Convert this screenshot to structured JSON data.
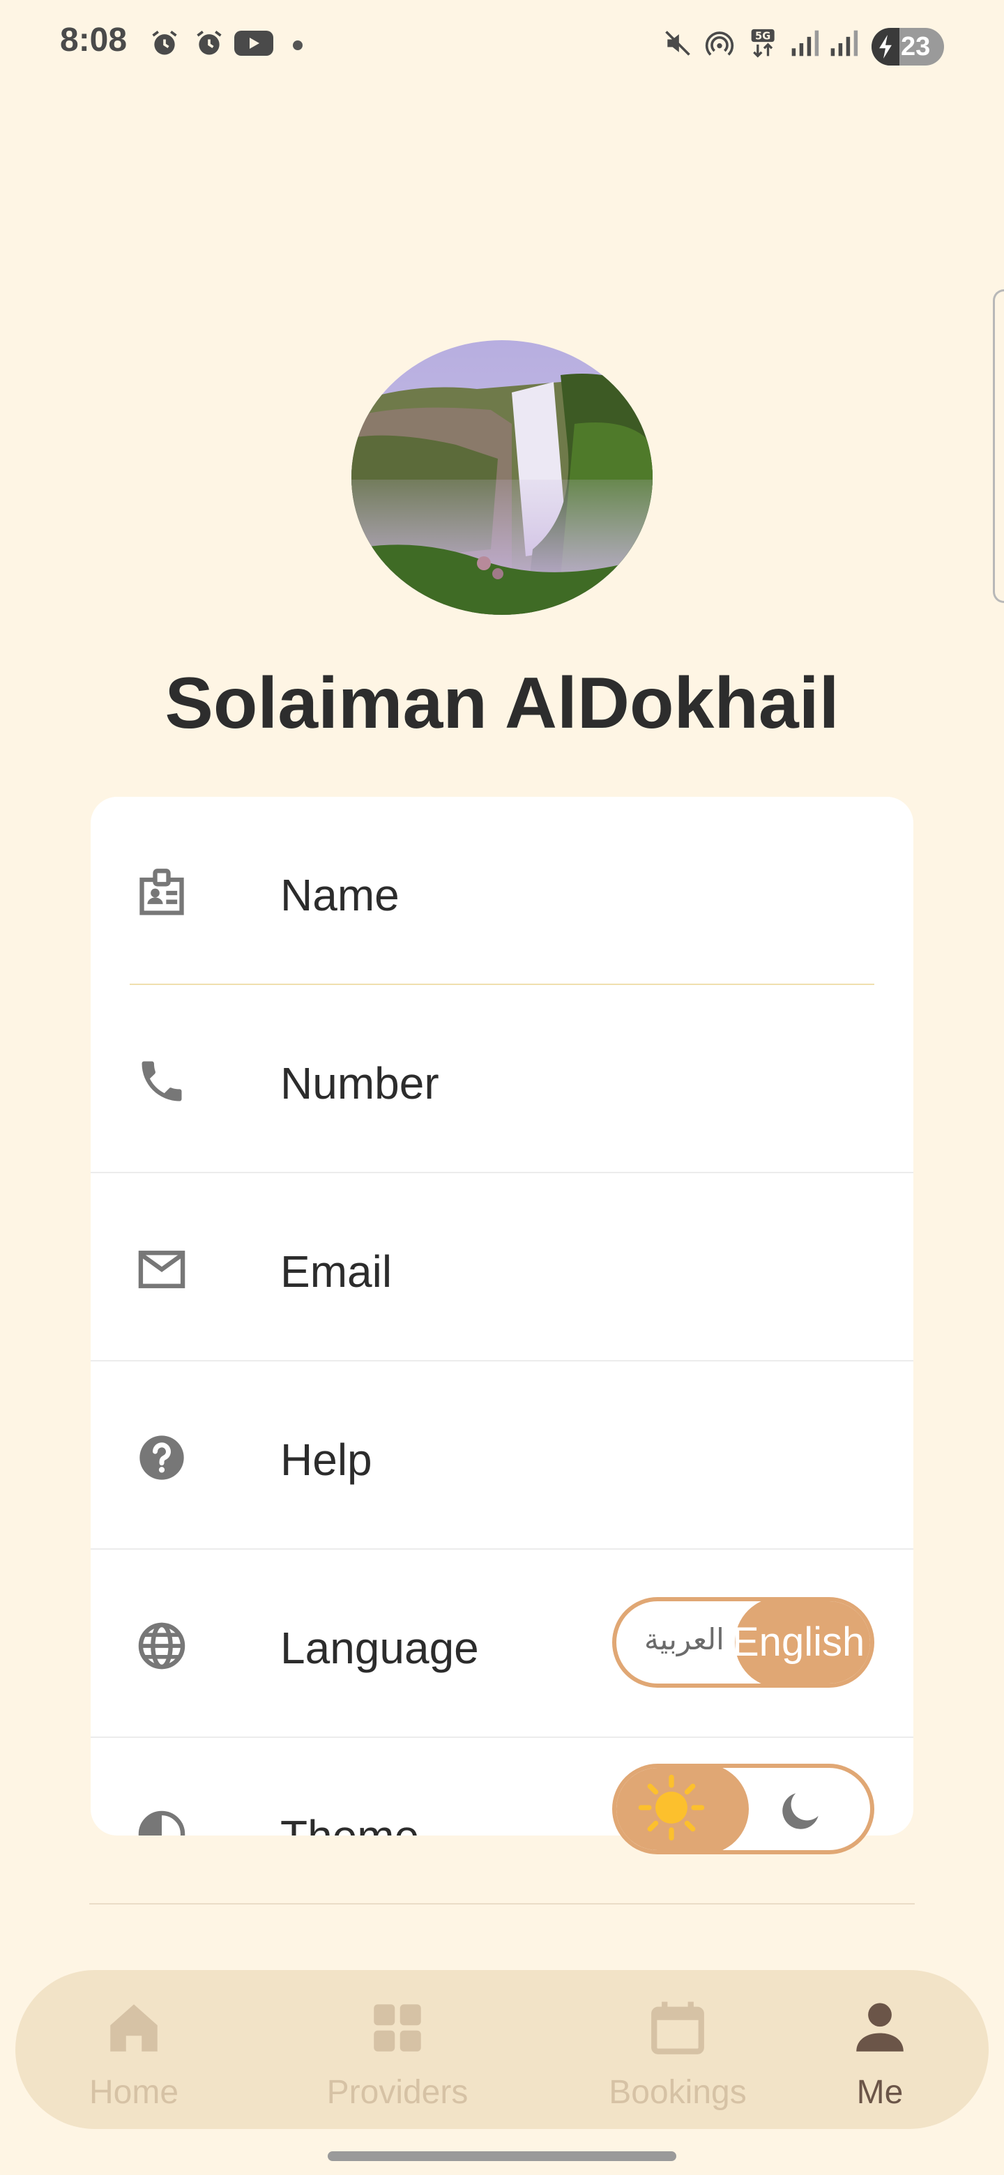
{
  "status_bar": {
    "time": "8:08",
    "icons": [
      "alarm-icon",
      "alarm-icon",
      "youtube-icon",
      "dot-icon",
      "mute-icon",
      "hotspot-icon",
      "5g-icon",
      "signal-icon",
      "signal-icon"
    ],
    "battery": "23"
  },
  "profile": {
    "name": "Solaiman AlDokhail"
  },
  "menu": [
    {
      "icon": "id-badge-icon",
      "label": "Name"
    },
    {
      "icon": "phone-icon",
      "label": "Number"
    },
    {
      "icon": "mail-icon",
      "label": "Email"
    },
    {
      "icon": "help-icon",
      "label": "Help"
    },
    {
      "icon": "globe-icon",
      "label": "Language"
    },
    {
      "icon": "contrast-icon",
      "label": "Theme"
    }
  ],
  "language_toggle": {
    "option_ar": "العربية",
    "option_en": "English",
    "selected": "English"
  },
  "theme_toggle": {
    "selected": "light"
  },
  "nav": {
    "items": [
      {
        "label": "Home",
        "icon": "home-icon"
      },
      {
        "label": "Providers",
        "icon": "grid-icon"
      },
      {
        "label": "Bookings",
        "icon": "calendar-icon"
      },
      {
        "label": "Me",
        "icon": "person-icon"
      }
    ],
    "active": "Me"
  },
  "colors": {
    "background": "#FEF5E4",
    "accent": "#E0A774",
    "nav_bg": "#F2E3C7",
    "nav_active": "#6b5548",
    "nav_inactive": "#d6c2a5"
  }
}
